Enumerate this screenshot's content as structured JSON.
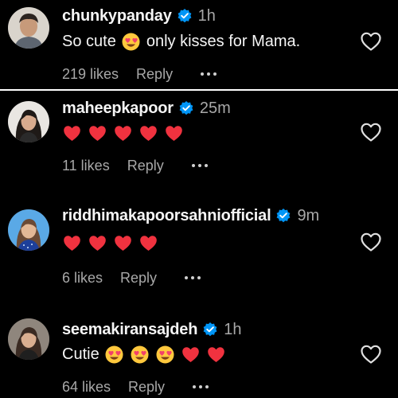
{
  "comments": [
    {
      "username": "chunkypanday",
      "verified": true,
      "time": "1h",
      "text_before": "So cute",
      "text_after": "only kisses for Mama.",
      "emojis": [
        "smiling-face-with-heart-eyes"
      ],
      "likes": "219 likes",
      "reply": "Reply"
    },
    {
      "username": "maheepkapoor",
      "verified": true,
      "time": "25m",
      "emojis": [
        "red-heart",
        "red-heart",
        "red-heart",
        "red-heart",
        "red-heart"
      ],
      "likes": "11 likes",
      "reply": "Reply"
    },
    {
      "username": "riddhimakapoorsahniofficial",
      "verified": true,
      "time": "9m",
      "emojis": [
        "red-heart",
        "red-heart",
        "red-heart",
        "red-heart"
      ],
      "likes": "6 likes",
      "reply": "Reply"
    },
    {
      "username": "seemakiransajdeh",
      "verified": true,
      "time": "1h",
      "text_before": "Cutie",
      "emojis": [
        "smiling-face-with-heart-eyes",
        "smiling-face-with-heart-eyes",
        "smiling-face-with-heart-eyes",
        "red-heart",
        "red-heart"
      ],
      "likes": "64 likes",
      "reply": "Reply"
    }
  ],
  "icons": {
    "verified": "verified-badge-icon",
    "like": "heart-outline-icon",
    "more": "more-options-icon"
  },
  "colors": {
    "background": "#000000",
    "separator": "#ffffff",
    "text_primary": "#f5f5f5",
    "text_secondary": "#a8a8a8",
    "verified_blue": "#0095f6",
    "heart_red": "#ff3040"
  }
}
